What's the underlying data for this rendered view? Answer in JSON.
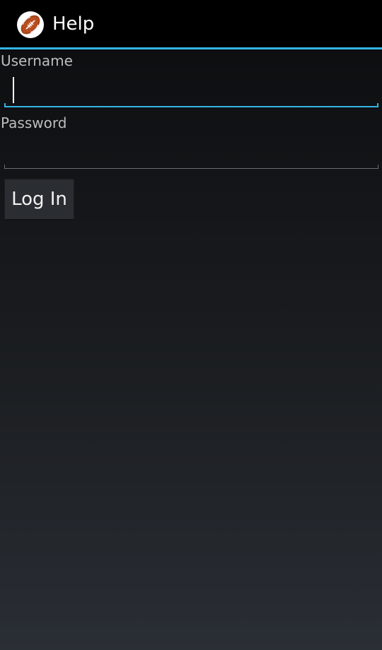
{
  "action_bar": {
    "title": "Help",
    "icon": "football-icon",
    "accent_color": "#33b5e5",
    "background_color": "#000000"
  },
  "form": {
    "username": {
      "label": "Username",
      "value": "",
      "focused": true
    },
    "password": {
      "label": "Password",
      "value": "",
      "focused": false
    },
    "login_button": {
      "label": "Log In"
    }
  }
}
